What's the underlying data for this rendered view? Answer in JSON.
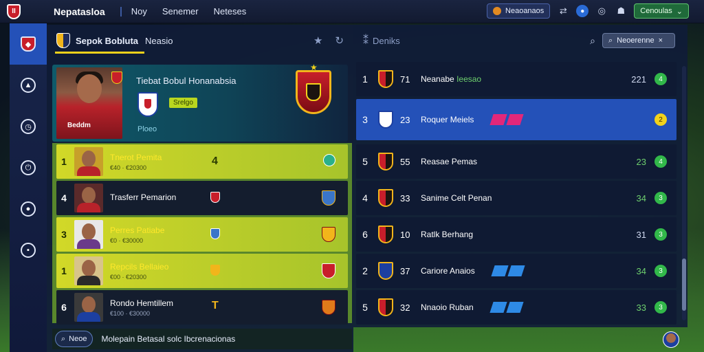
{
  "topbar": {
    "title": "Nepatasloa",
    "links": [
      "Noy",
      "Senemer",
      "Neteses"
    ],
    "pill_label": "Neaoanaos",
    "account_label": "Cenoulas"
  },
  "sidebar": {
    "items": [
      {
        "icon": "club-crest-icon",
        "active": true
      },
      {
        "icon": "boot-icon"
      },
      {
        "icon": "clock-icon"
      },
      {
        "icon": "power-icon"
      },
      {
        "icon": "ball-icon"
      },
      {
        "icon": "chat-icon"
      }
    ]
  },
  "left_panel": {
    "title": "Sepok Bobluta",
    "subtitle": "Neasio",
    "profile": {
      "name": "Tiebat Bobul Honanabsia",
      "photo_caption": "Beddm",
      "tag": "Srelgo",
      "code": "Ploeo"
    },
    "players": [
      {
        "num": "1",
        "name": "Tnerot Pemita",
        "meta": "€40 · €20300",
        "mid": "4",
        "highlight": true
      },
      {
        "num": "4",
        "name": "Trasferr Pemarion",
        "meta": "",
        "mid": ""
      },
      {
        "num": "3",
        "name": "Perres Patiabe",
        "meta": "€0 · €30000",
        "mid": "",
        "highlight": true
      },
      {
        "num": "1",
        "name": "Repcils Bellaieo",
        "meta": "€00 · €20300",
        "mid": "",
        "highlight": true
      },
      {
        "num": "6",
        "name": "Rondo Hemtillem",
        "meta": "€100 · €30000",
        "mid": "T"
      }
    ],
    "search_button": "Neoe",
    "search_text": "Molepain Betasal solc Ibcrenacionas"
  },
  "right_panel": {
    "title": "Deniks",
    "search_placeholder": "Neoerenne",
    "rows": [
      {
        "pos": "1",
        "score": "71",
        "name": "Neanabe",
        "accent": "Ieesao",
        "val": "221",
        "badge": "4"
      },
      {
        "pos": "3",
        "score": "23",
        "name": "Roquer Meiels",
        "val": "",
        "badge": "2",
        "selected": true,
        "tags": "pink"
      },
      {
        "pos": "5",
        "score": "55",
        "name": "Reasae Pemas",
        "val": "23",
        "badge": "4"
      },
      {
        "pos": "4",
        "score": "33",
        "name": "Sanime Celt Penan",
        "val": "34",
        "badge": "3"
      },
      {
        "pos": "6",
        "score": "10",
        "name": "Ratlk Berhang",
        "val": "31",
        "badge": "3"
      },
      {
        "pos": "2",
        "score": "37",
        "name": "Cariore Anaios",
        "val": "34",
        "badge": "3",
        "tags": "blue"
      },
      {
        "pos": "5",
        "score": "32",
        "name": "Nnaoio Ruban",
        "val": "33",
        "badge": "3",
        "tags": "blue"
      }
    ]
  }
}
